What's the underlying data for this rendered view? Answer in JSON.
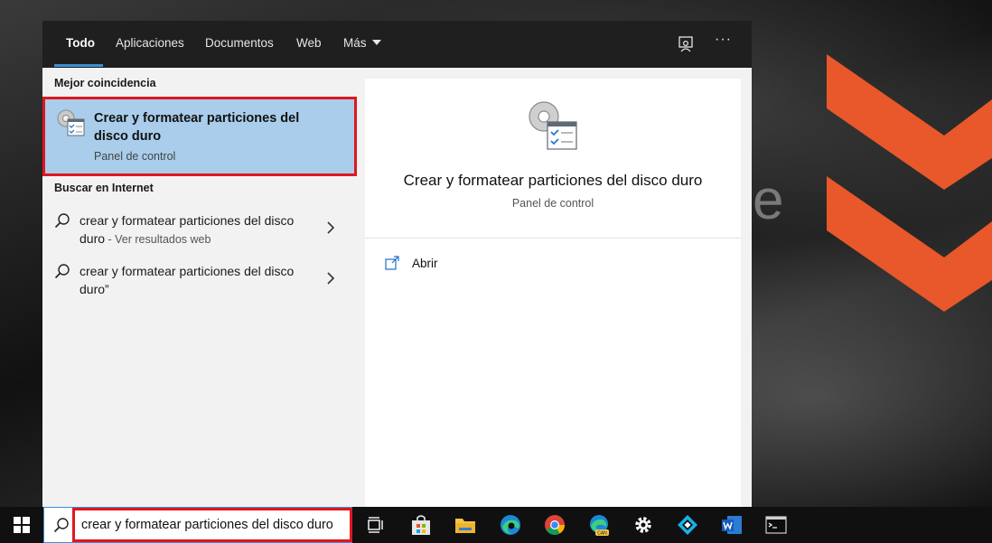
{
  "tabs": [
    {
      "label": "Todo",
      "active": true
    },
    {
      "label": "Aplicaciones",
      "active": false
    },
    {
      "label": "Documentos",
      "active": false
    },
    {
      "label": "Web",
      "active": false
    },
    {
      "label": "Más",
      "active": false
    }
  ],
  "toolbar": {
    "feedback_icon": "feedback-icon",
    "more_label": "···"
  },
  "best_match": {
    "heading": "Mejor coincidencia",
    "title": "Crear y formatear particiones del disco duro",
    "subtitle": "Panel de control",
    "icon": "control-panel-settings-icon"
  },
  "web": {
    "heading": "Buscar en Internet",
    "items": [
      {
        "text": "crear y formatear particiones del disco duro",
        "hint": " - Ver resultados web"
      },
      {
        "text": "crear y formatear particiones del disco duro”",
        "hint": ""
      }
    ]
  },
  "detail": {
    "title": "Crear y formatear particiones del disco duro",
    "subtitle": "Panel de control",
    "actions": [
      {
        "label": "Abrir",
        "icon": "open-icon"
      }
    ]
  },
  "taskbar": {
    "search_value": "crear y formatear particiones del disco duro",
    "icons": [
      "start-icon",
      "task-view-icon",
      "microsoft-store-icon",
      "file-explorer-icon",
      "edge-icon",
      "chrome-icon",
      "edge-canary-icon",
      "settings-icon",
      "kodi-icon",
      "word-icon",
      "terminal-icon"
    ]
  },
  "colors": {
    "accent": "#3b8fd9",
    "highlight": "#a9cdeb",
    "annotation": "#e0161e",
    "brand_logo": "#e8582a"
  },
  "desktop": {
    "letter": "e"
  }
}
